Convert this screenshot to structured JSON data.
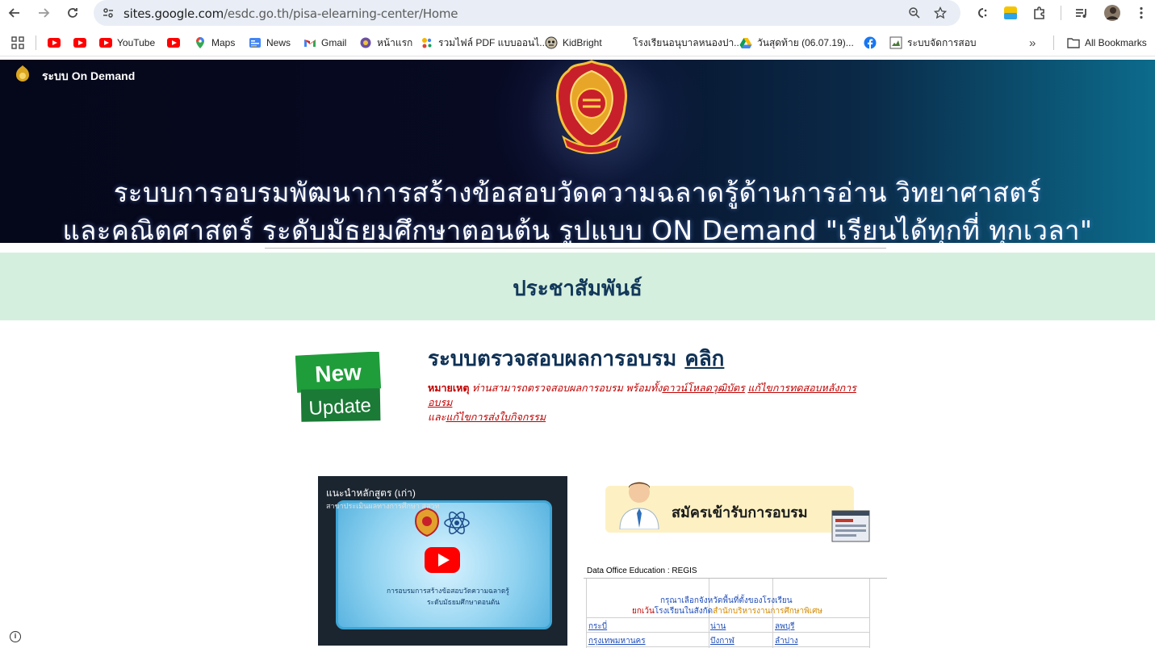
{
  "browser": {
    "url_host": "sites.google.com",
    "url_path": "/esdc.go.th/pisa-elearning-center/Home"
  },
  "bookmarks": [
    {
      "label": "",
      "icon": "youtube-icon"
    },
    {
      "label": "",
      "icon": "youtube-icon"
    },
    {
      "label": "YouTube",
      "icon": "youtube-icon"
    },
    {
      "label": "",
      "icon": "youtube-icon"
    },
    {
      "label": "Maps",
      "icon": "maps-icon"
    },
    {
      "label": "News",
      "icon": "news-icon"
    },
    {
      "label": "Gmail",
      "icon": "gmail-icon"
    },
    {
      "label": "หน้าแรก",
      "icon": "site-icon"
    },
    {
      "label": "รวมไฟล์ PDF แบบออนไ...",
      "icon": "tool-icon"
    },
    {
      "label": "KidBright",
      "icon": "kidbright-icon"
    },
    {
      "label": "โรงเรียนอนุบาลหนองปา...",
      "icon": "page-icon"
    },
    {
      "label": "วันสุดท้าย (06.07.19)...",
      "icon": "drive-icon"
    },
    {
      "label": "",
      "icon": "facebook-icon"
    },
    {
      "label": "ระบบจัดการสอบ",
      "icon": "page-icon"
    }
  ],
  "all_bookmarks_label": "All Bookmarks",
  "site": {
    "title": "ระบบ On Demand",
    "banner_line1": "ระบบการอบรมพัฒนาการสร้างข้อสอบวัดความฉลาดรู้ด้านการอ่าน วิทยาศาสตร์",
    "banner_line2": "และคณิตศาสตร์ ระดับมัธยมศึกษาตอนต้น รูปแบบ ON Demand \"เรียนได้ทุกที่ ทุกเวลา\""
  },
  "pr_title": "ประชาสัมพันธ์",
  "badge": {
    "line1": "New",
    "line2": "Update"
  },
  "check": {
    "title": "ระบบตรวจสอบผลการอบรม",
    "link": "คลิก",
    "note_label": "หมายเหตุ",
    "note_text": " ท่านสามารถตรวจสอบผลการอบรม พร้อมทั้ง",
    "note_link1": "ดาวน์โหลดวุฒิบัตร",
    "note_link2": "แก้ไขการทดสอบหลังการอบรม",
    "note_and": "และ",
    "note_link3": "แก้ไขการส่งใบกิจกรรม"
  },
  "video": {
    "title": "แนะนำหลักสูตร (เก่า)",
    "subtitle": "สาขาประเมินผลทางการศึกษา สสวท",
    "caption1": "การอบรมการสร้างข้อสอบวัดความฉลาดรู้",
    "caption2": "ระดับมัธยมศึกษาตอนต้น"
  },
  "register": {
    "label": "สมัครเข้ารับการอบรม"
  },
  "sheet": {
    "label": "Data Office Education : REGIS",
    "header1": "กรุณาเลือกจังหวัดพื้นที่ตั้งของโรงเรียน",
    "header2_red": "ยกเว้น",
    "header2_blue": "โรงเรียนในสังกัด",
    "header2_orange": "สำนักบริหารงานการศึกษาพิเศษ",
    "rows": [
      [
        "กระบี่",
        "น่าน",
        "ลพบุรี"
      ],
      [
        "กรุงเทพมหานคร",
        "บึงกาฬ",
        "ลำปาง"
      ]
    ]
  },
  "colors": {
    "banner_dark": "#05071a",
    "banner_teal": "#0c6b8c",
    "pr_band": "#d5efde",
    "heading": "#12385a",
    "note_red": "#c00000"
  }
}
